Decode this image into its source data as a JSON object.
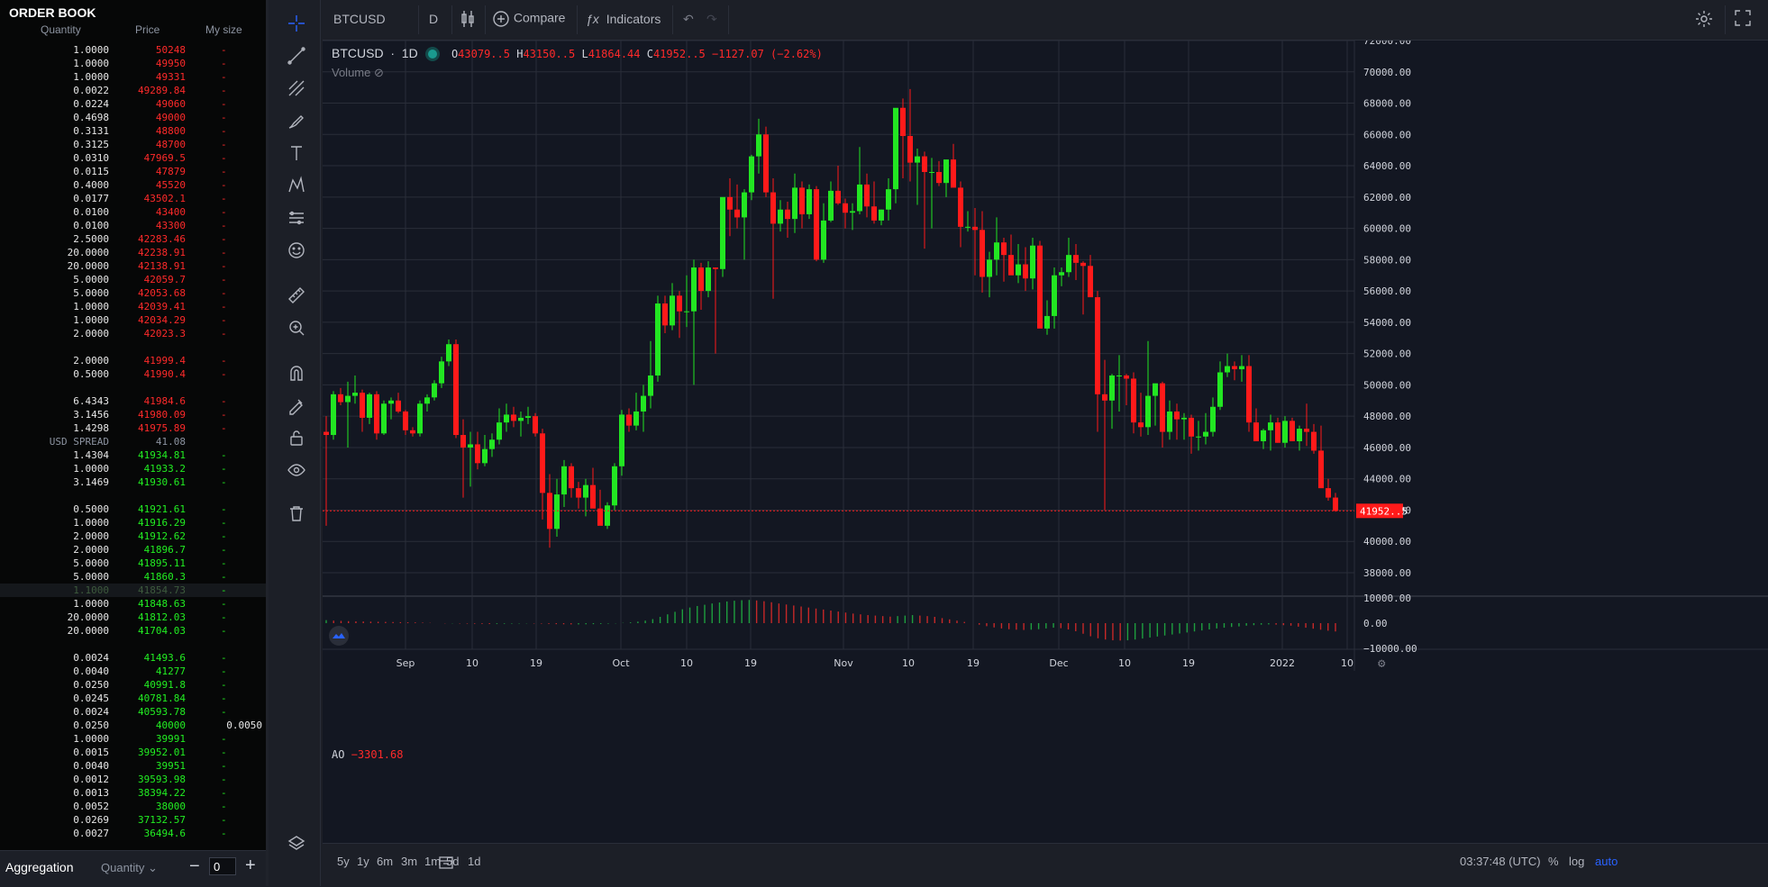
{
  "orderbook": {
    "title": "ORDER BOOK",
    "headers": {
      "quantity": "Quantity",
      "price": "Price",
      "mysize": "My size"
    },
    "asks": [
      {
        "q": "1.0000",
        "p": "50248",
        "m": "-"
      },
      {
        "q": "1.0000",
        "p": "49950",
        "m": "-"
      },
      {
        "q": "1.0000",
        "p": "49331",
        "m": "-"
      },
      {
        "q": "0.0022",
        "p": "49289.84",
        "m": "-"
      },
      {
        "q": "0.0224",
        "p": "49060",
        "m": "-"
      },
      {
        "q": "0.4698",
        "p": "49000",
        "m": "-"
      },
      {
        "q": "0.3131",
        "p": "48800",
        "m": "-"
      },
      {
        "q": "0.3125",
        "p": "48700",
        "m": "-"
      },
      {
        "q": "0.0310",
        "p": "47969.5",
        "m": "-"
      },
      {
        "q": "0.0115",
        "p": "47879",
        "m": "-"
      },
      {
        "q": "0.4000",
        "p": "45520",
        "m": "-"
      },
      {
        "q": "0.0177",
        "p": "43502.1",
        "m": "-"
      },
      {
        "q": "0.0100",
        "p": "43400",
        "m": "-"
      },
      {
        "q": "0.0100",
        "p": "43300",
        "m": "-"
      },
      {
        "q": "2.5000",
        "p": "42283.46",
        "m": "-"
      },
      {
        "q": "20.0000",
        "p": "42238.91",
        "m": "-"
      },
      {
        "q": "20.0000",
        "p": "42138.91",
        "m": "-"
      },
      {
        "q": "5.0000",
        "p": "42059.7",
        "m": "-"
      },
      {
        "q": "5.0000",
        "p": "42053.68",
        "m": "-"
      },
      {
        "q": "1.0000",
        "p": "42039.41",
        "m": "-"
      },
      {
        "q": "1.0000",
        "p": "42034.29",
        "m": "-"
      },
      {
        "q": "2.0000",
        "p": "42023.3",
        "m": "-"
      },
      {
        "q": "2.0000",
        "p": "41999.4",
        "m": "-"
      },
      {
        "q": "0.5000",
        "p": "41990.4",
        "m": "-"
      },
      {
        "q": "6.4343",
        "p": "41984.6",
        "m": "-"
      },
      {
        "q": "3.1456",
        "p": "41980.09",
        "m": "-"
      },
      {
        "q": "1.4298",
        "p": "41975.89",
        "m": "-"
      }
    ],
    "spread": {
      "label": "USD SPREAD",
      "value": "41.08"
    },
    "bids": [
      {
        "q": "1.4304",
        "p": "41934.81",
        "m": "-"
      },
      {
        "q": "1.0000",
        "p": "41933.2",
        "m": "-"
      },
      {
        "q": "3.1469",
        "p": "41930.61",
        "m": "-"
      },
      {
        "q": "0.5000",
        "p": "41921.61",
        "m": "-"
      },
      {
        "q": "1.0000",
        "p": "41916.29",
        "m": "-"
      },
      {
        "q": "2.0000",
        "p": "41912.62",
        "m": "-"
      },
      {
        "q": "2.0000",
        "p": "41896.7",
        "m": "-"
      },
      {
        "q": "5.0000",
        "p": "41895.11",
        "m": "-"
      },
      {
        "q": "5.0000",
        "p": "41860.3",
        "m": "-"
      },
      {
        "q": "1.1000",
        "p": "41854.73",
        "m": "-"
      },
      {
        "q": "1.0000",
        "p": "41848.63",
        "m": "-"
      },
      {
        "q": "20.0000",
        "p": "41812.03",
        "m": "-"
      },
      {
        "q": "20.0000",
        "p": "41704.03",
        "m": "-"
      },
      {
        "q": "0.0024",
        "p": "41493.6",
        "m": "-"
      },
      {
        "q": "0.0040",
        "p": "41277",
        "m": "-"
      },
      {
        "q": "0.0250",
        "p": "40991.8",
        "m": "-"
      },
      {
        "q": "0.0245",
        "p": "40781.84",
        "m": "-"
      },
      {
        "q": "0.0024",
        "p": "40593.78",
        "m": "-"
      },
      {
        "q": "0.0250",
        "p": "40000",
        "m": "0.0050"
      },
      {
        "q": "1.0000",
        "p": "39991",
        "m": "-"
      },
      {
        "q": "0.0015",
        "p": "39952.01",
        "m": "-"
      },
      {
        "q": "0.0040",
        "p": "39951",
        "m": "-"
      },
      {
        "q": "0.0012",
        "p": "39593.98",
        "m": "-"
      },
      {
        "q": "0.0013",
        "p": "38394.22",
        "m": "-"
      },
      {
        "q": "0.0052",
        "p": "38000",
        "m": "-"
      },
      {
        "q": "0.0269",
        "p": "37132.57",
        "m": "-"
      },
      {
        "q": "0.0027",
        "p": "36494.6",
        "m": "-"
      }
    ],
    "footer": {
      "aggregation": "Aggregation",
      "select": "Quantity",
      "minus": "−",
      "value": "0",
      "plus": "+"
    }
  },
  "topbar": {
    "symbol": "BTCUSD",
    "interval": "D",
    "compare": "Compare",
    "indicators": "Indicators"
  },
  "legend": {
    "symbol": "BTCUSD",
    "interval": "1D",
    "o": "43079..5",
    "h": "43150..5",
    "l": "41864.44",
    "c": "41952..5",
    "change": "−1127.07 (−2.62%)",
    "volume": "Volume"
  },
  "ao": {
    "label": "AO",
    "value": "−3301.68"
  },
  "bottombar": {
    "ranges": [
      "5y",
      "1y",
      "6m",
      "3m",
      "1m",
      "5d",
      "1d"
    ],
    "time": "03:37:48 (UTC)",
    "percent": "%",
    "log": "log",
    "auto": "auto"
  },
  "colors": {
    "up": "#22e622",
    "down": "#ff1a1a",
    "bg": "#131722",
    "grid": "#2a2e39",
    "accent": "#2962ff"
  },
  "icons": [
    "crosshair-icon",
    "trendline-icon",
    "fib-icon",
    "brush-icon",
    "text-icon",
    "pattern-icon",
    "forecast-icon",
    "emoji-icon",
    "ruler-icon",
    "zoom-icon",
    "magnet-icon",
    "lock-drawing-icon",
    "lock-icon",
    "eye-icon",
    "trash-icon",
    "layers-icon"
  ],
  "chart_data": {
    "type": "candlestick",
    "title": "BTCUSD 1D",
    "ylim": [
      36000,
      72000
    ],
    "yticks": [
      "72000.00",
      "70000.00",
      "68000.00",
      "66000.00",
      "64000.00",
      "62000.00",
      "60000.00",
      "58000.00",
      "56000.00",
      "54000.00",
      "52000.00",
      "50000.00",
      "48000.00",
      "46000.00",
      "44000.00",
      "42000.00",
      "40000.00",
      "38000.00"
    ],
    "xticks": [
      "Sep",
      "10",
      "19",
      "Oct",
      "10",
      "19",
      "Nov",
      "10",
      "19",
      "Dec",
      "10",
      "19",
      "2022",
      "10"
    ],
    "last_price_label": "41952..5",
    "candles": [
      [
        47000,
        48000,
        41000,
        46800
      ],
      [
        46800,
        49600,
        46500,
        49400
      ],
      [
        49400,
        49800,
        48700,
        48900
      ],
      [
        48900,
        50200,
        46000,
        49300
      ],
      [
        49300,
        50600,
        48800,
        49500
      ],
      [
        49500,
        49700,
        47000,
        47900
      ],
      [
        47900,
        49500,
        47500,
        49400
      ],
      [
        49400,
        49600,
        46500,
        46900
      ],
      [
        46900,
        49000,
        46800,
        48800
      ],
      [
        48800,
        49200,
        47800,
        49000
      ],
      [
        49000,
        49500,
        48200,
        48300
      ],
      [
        48300,
        48400,
        46800,
        47100
      ],
      [
        47100,
        47300,
        46700,
        46900
      ],
      [
        46900,
        49000,
        46700,
        48800
      ],
      [
        48800,
        49400,
        48300,
        49200
      ],
      [
        49200,
        50300,
        49000,
        50100
      ],
      [
        50100,
        51800,
        49800,
        51500
      ],
      [
        51500,
        52900,
        51200,
        52600
      ],
      [
        52600,
        52900,
        46600,
        46800
      ],
      [
        46800,
        47800,
        42800,
        46000
      ],
      [
        46000,
        47000,
        43500,
        46200
      ],
      [
        46200,
        47000,
        44600,
        45000
      ],
      [
        45000,
        46800,
        44800,
        45900
      ],
      [
        45900,
        46900,
        45400,
        46500
      ],
      [
        46500,
        48500,
        46200,
        47600
      ],
      [
        47600,
        48800,
        47000,
        48100
      ],
      [
        48100,
        48600,
        47300,
        47700
      ],
      [
        47700,
        48300,
        46700,
        47900
      ],
      [
        47900,
        48600,
        47500,
        48000
      ],
      [
        48000,
        48200,
        46700,
        46900
      ],
      [
        46900,
        47200,
        41400,
        43100
      ],
      [
        43100,
        44300,
        39600,
        40800
      ],
      [
        40800,
        44000,
        40300,
        43000
      ],
      [
        43000,
        45200,
        42200,
        44800
      ],
      [
        44800,
        45000,
        42800,
        43400
      ],
      [
        43400,
        43800,
        42100,
        42800
      ],
      [
        42800,
        44000,
        41600,
        43600
      ],
      [
        43600,
        44700,
        42300,
        42100
      ],
      [
        42100,
        43300,
        41200,
        41000
      ],
      [
        41000,
        42500,
        40800,
        42300
      ],
      [
        42300,
        45000,
        42000,
        44800
      ],
      [
        44800,
        48400,
        44200,
        48100
      ],
      [
        48100,
        48500,
        47000,
        47400
      ],
      [
        47400,
        49500,
        47100,
        48300
      ],
      [
        48300,
        50000,
        47000,
        49300
      ],
      [
        49300,
        52800,
        48500,
        50600
      ],
      [
        50600,
        55700,
        50200,
        55200
      ],
      [
        55200,
        55700,
        53300,
        53800
      ],
      [
        53800,
        56500,
        53500,
        55700
      ],
      [
        55700,
        56000,
        53000,
        54700
      ],
      [
        54700,
        57000,
        53700,
        54700
      ],
      [
        54700,
        58000,
        50000,
        57500
      ],
      [
        57500,
        57800,
        54800,
        56000
      ],
      [
        56000,
        57900,
        55600,
        57500
      ],
      [
        57500,
        57500,
        52000,
        57400
      ],
      [
        57400,
        62000,
        56900,
        62000
      ],
      [
        62000,
        63200,
        59500,
        61200
      ],
      [
        61200,
        62800,
        60000,
        60700
      ],
      [
        60700,
        62500,
        58000,
        62300
      ],
      [
        62300,
        64700,
        61800,
        64600
      ],
      [
        64600,
        67000,
        63500,
        66000
      ],
      [
        66000,
        66500,
        62000,
        62300
      ],
      [
        62300,
        63200,
        55500,
        60300
      ],
      [
        60300,
        61800,
        59800,
        61200
      ],
      [
        61200,
        61700,
        59400,
        60600
      ],
      [
        60600,
        63500,
        59700,
        62600
      ],
      [
        62600,
        63000,
        60000,
        60900
      ],
      [
        60900,
        62800,
        60600,
        62500
      ],
      [
        62500,
        62700,
        57900,
        58000
      ],
      [
        58000,
        61600,
        57800,
        60500
      ],
      [
        60500,
        63000,
        60400,
        62400
      ],
      [
        62400,
        64000,
        61500,
        61600
      ],
      [
        61600,
        61900,
        60000,
        61000
      ],
      [
        61000,
        61600,
        59900,
        61100
      ],
      [
        61100,
        65200,
        60900,
        62800
      ],
      [
        62800,
        63500,
        60700,
        61400
      ],
      [
        61400,
        63000,
        60300,
        60500
      ],
      [
        60500,
        61200,
        60200,
        61200
      ],
      [
        61200,
        63200,
        60500,
        62500
      ],
      [
        62500,
        66200,
        61600,
        67700
      ],
      [
        67700,
        68300,
        63200,
        65900
      ],
      [
        65900,
        68900,
        63000,
        64200
      ],
      [
        64200,
        65100,
        61500,
        64600
      ],
      [
        64600,
        64900,
        58700,
        63600
      ],
      [
        63600,
        64500,
        60000,
        63600
      ],
      [
        63600,
        64300,
        62700,
        62900
      ],
      [
        62900,
        64200,
        62000,
        64400
      ],
      [
        64400,
        65400,
        63300,
        62600
      ],
      [
        62600,
        63000,
        58800,
        60100
      ],
      [
        60100,
        61100,
        59800,
        60100
      ],
      [
        60100,
        61300,
        57000,
        59900
      ],
      [
        59900,
        61100,
        55900,
        56900
      ],
      [
        56900,
        58500,
        55600,
        58000
      ],
      [
        58000,
        60700,
        57000,
        59100
      ],
      [
        59100,
        59400,
        56600,
        58300
      ],
      [
        58300,
        59600,
        57300,
        57000
      ],
      [
        57000,
        59000,
        56500,
        57700
      ],
      [
        57700,
        58800,
        56000,
        56800
      ],
      [
        56800,
        59400,
        56100,
        58900
      ],
      [
        58900,
        59200,
        53700,
        53600
      ],
      [
        53600,
        55400,
        53200,
        54400
      ],
      [
        54400,
        57500,
        53600,
        57000
      ],
      [
        57000,
        57500,
        56300,
        57200
      ],
      [
        57200,
        59400,
        56900,
        58300
      ],
      [
        58300,
        59000,
        56700,
        57800
      ],
      [
        57800,
        57900,
        54500,
        57600
      ],
      [
        57600,
        58300,
        55800,
        55600
      ],
      [
        55600,
        56000,
        47000,
        49400
      ],
      [
        49400,
        51600,
        42000,
        49000
      ],
      [
        49000,
        50700,
        47200,
        50600
      ],
      [
        50600,
        51900,
        48300,
        50600
      ],
      [
        50600,
        50700,
        48700,
        50400
      ],
      [
        50400,
        50800,
        46900,
        47600
      ],
      [
        47600,
        49500,
        46700,
        47300
      ],
      [
        47300,
        52800,
        46800,
        49300
      ],
      [
        49300,
        50000,
        47400,
        50100
      ],
      [
        50100,
        50200,
        46000,
        47000
      ],
      [
        47000,
        49000,
        46500,
        48300
      ],
      [
        48300,
        48800,
        46500,
        47800
      ],
      [
        47800,
        48200,
        46500,
        47900
      ],
      [
        47900,
        48100,
        45600,
        46700
      ],
      [
        46700,
        47700,
        45800,
        46700
      ],
      [
        46700,
        48200,
        46200,
        47000
      ],
      [
        47000,
        49200,
        46700,
        48600
      ],
      [
        48600,
        51500,
        48400,
        50800
      ],
      [
        50800,
        52000,
        50500,
        51200
      ],
      [
        51200,
        51500,
        50300,
        51000
      ],
      [
        51000,
        51900,
        50200,
        51200
      ],
      [
        51200,
        51900,
        47000,
        47600
      ],
      [
        47600,
        48500,
        46400,
        46400
      ],
      [
        46400,
        47200,
        45900,
        47100
      ],
      [
        47100,
        48100,
        45800,
        47600
      ],
      [
        47600,
        47900,
        46300,
        46300
      ],
      [
        46300,
        48000,
        46000,
        47700
      ],
      [
        47700,
        47900,
        46500,
        46400
      ],
      [
        46400,
        47400,
        45800,
        47200
      ],
      [
        47200,
        48800,
        46100,
        47000
      ],
      [
        47000,
        47500,
        45600,
        45800
      ],
      [
        45800,
        47400,
        45500,
        43400
      ],
      [
        43400,
        44000,
        42600,
        42800
      ],
      [
        42800,
        43100,
        41900,
        41952
      ]
    ],
    "ao_values": [
      1200,
      1000,
      900,
      800,
      700,
      650,
      600,
      550,
      500,
      450,
      400,
      350,
      300,
      200,
      100,
      0,
      -100,
      -100,
      -150,
      -200,
      -250,
      -300,
      -350,
      -300,
      -250,
      -200,
      -150,
      -100,
      -150,
      -200,
      -300,
      -400,
      -450,
      -500,
      -500,
      -450,
      -400,
      -300,
      -200,
      -100,
      100,
      300,
      600,
      1000,
      1600,
      2500,
      3500,
      4500,
      5500,
      6200,
      6800,
      7300,
      7800,
      8200,
      8600,
      8900,
      9100,
      9200,
      9000,
      8700,
      8300,
      7800,
      7400,
      7000,
      6600,
      6200,
      5800,
      5400,
      5000,
      4600,
      4200,
      3800,
      3500,
      3200,
      3000,
      2800,
      2600,
      2800,
      3000,
      3200,
      3000,
      2800,
      2500,
      2000,
      1500,
      1000,
      500,
      0,
      -600,
      -1200,
      -1700,
      -2100,
      -2400,
      -2600,
      -2700,
      -2600,
      -2400,
      -2100,
      -1800,
      -2000,
      -2500,
      -3200,
      -4200,
      -5200,
      -6000,
      -6500,
      -6800,
      -6900,
      -6800,
      -6500,
      -6100,
      -5700,
      -5300,
      -4900,
      -4500,
      -4100,
      -3700,
      -3300,
      -2900,
      -2500,
      -2100,
      -1800,
      -1500,
      -1300,
      -1000,
      -800,
      -600,
      -500,
      -600,
      -800,
      -1000,
      -1400,
      -1800,
      -2200,
      -2600,
      -3000,
      -3301
    ]
  }
}
